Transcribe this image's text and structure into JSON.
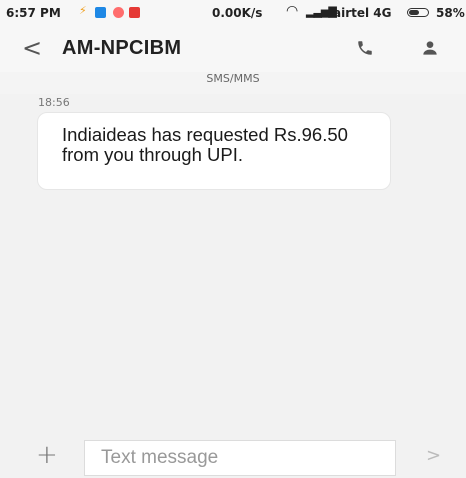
{
  "status_bar": {
    "time": "6:57 PM",
    "speed": "0.00K/s",
    "carrier": "airtel 4G",
    "battery_percent": "58%",
    "battery_level": 0.58
  },
  "header": {
    "back_label": "<",
    "title": "AM-NPCIBM"
  },
  "conversation": {
    "channel_label": "SMS/MMS",
    "messages": [
      {
        "time": "18:56",
        "text": "Indiaideas has requested Rs.96.50 from you through UPI."
      }
    ]
  },
  "composer": {
    "add_label": "+",
    "placeholder": "Text message",
    "send_label": ">"
  },
  "colors": {
    "background": "#f2f2f2",
    "bubble": "#ffffff"
  }
}
